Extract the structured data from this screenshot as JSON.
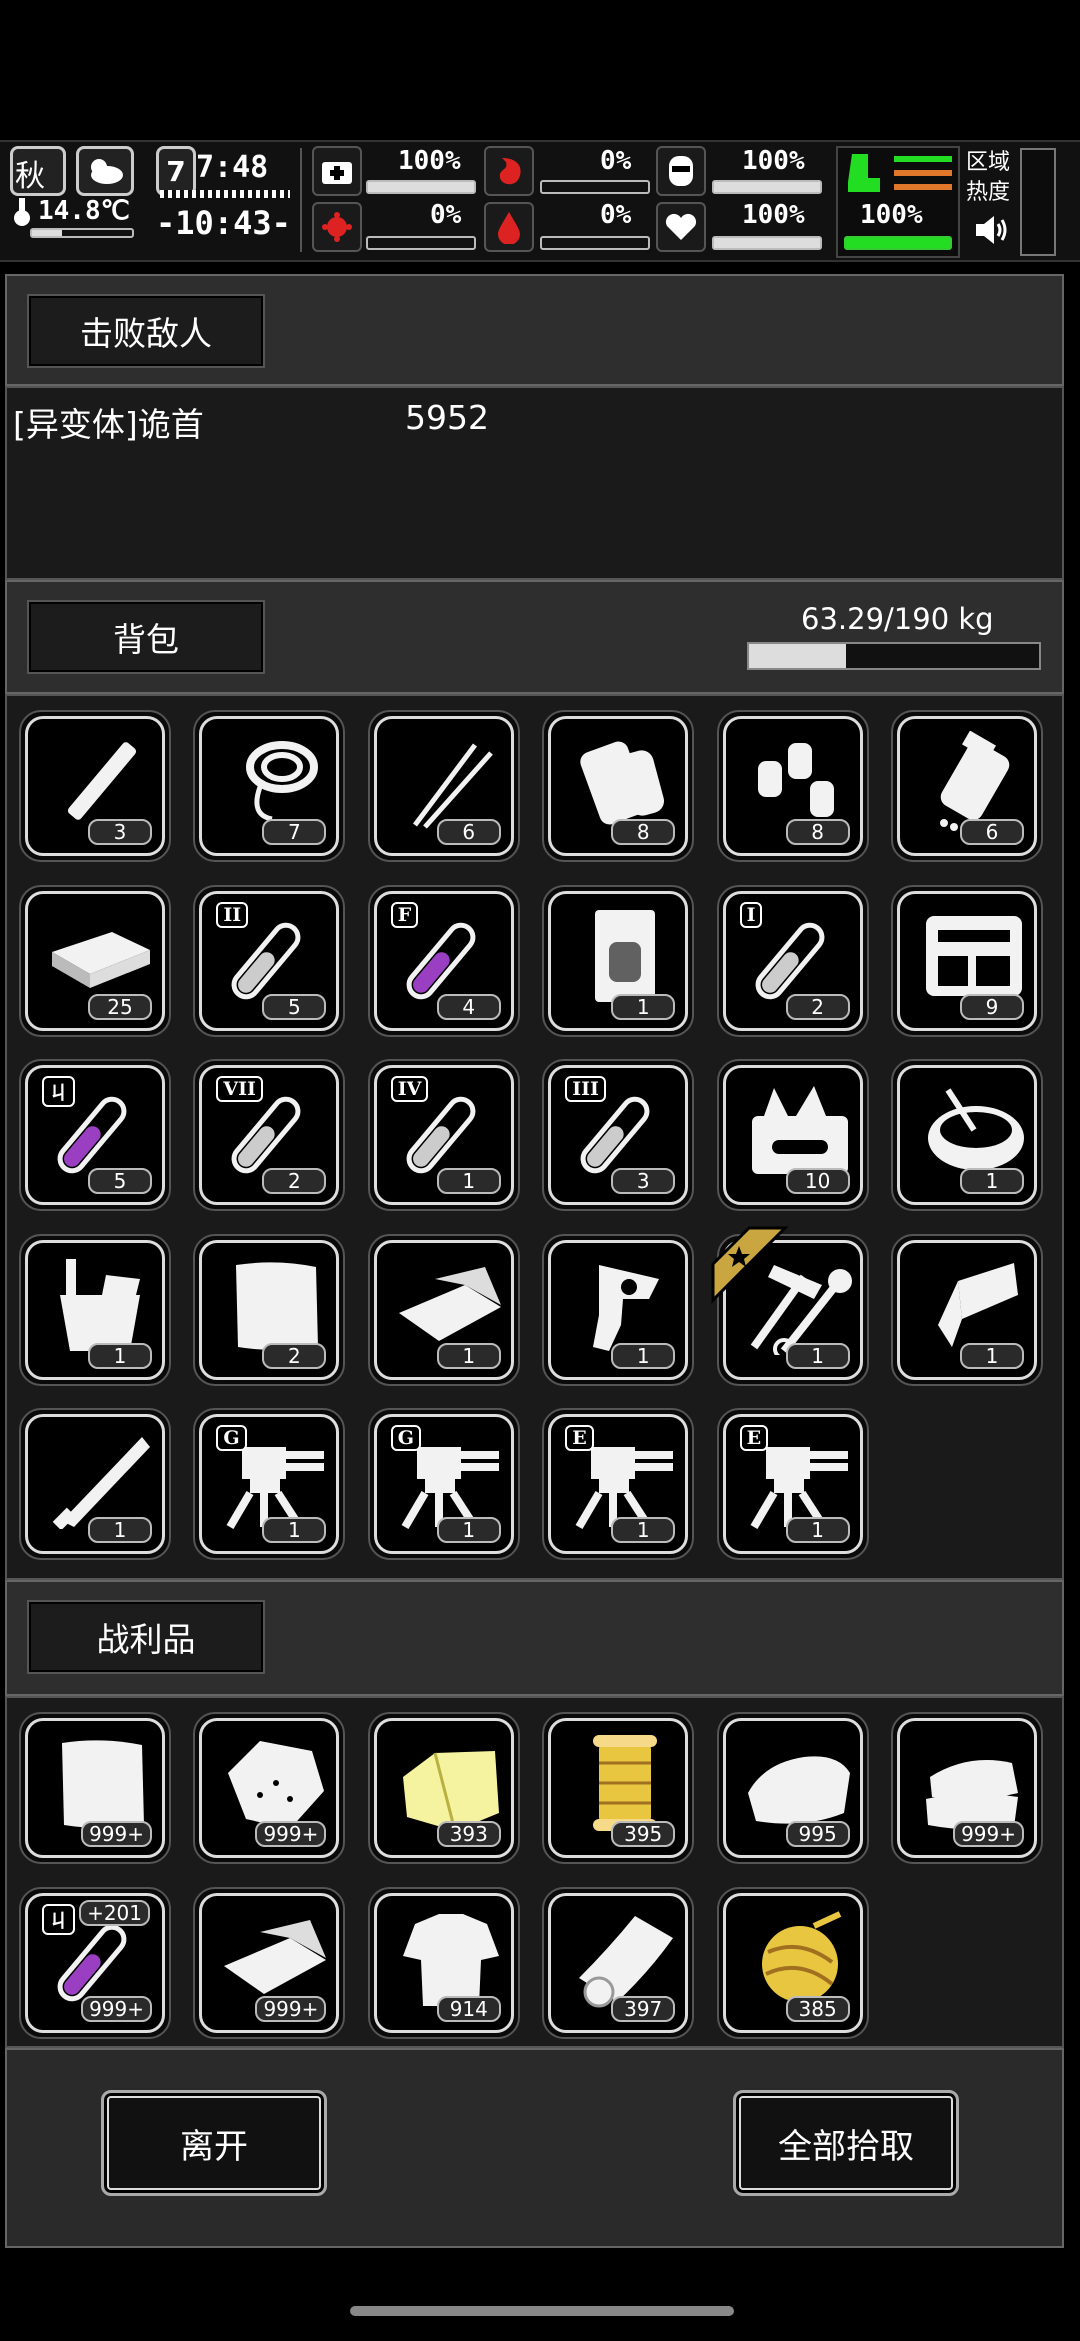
{
  "status": {
    "season": "秋",
    "day": "7",
    "day_time": "7:48",
    "temperature": "14.8℃",
    "clock": "-10:43-",
    "health": "100%",
    "hunger": "0%",
    "armor": "100%",
    "virus": "0%",
    "bleeding": "0%",
    "mood": "100%",
    "stamina": "100%",
    "zone_heat_label": "区域热度",
    "colors": {
      "green": "#22dd22",
      "red": "#dd2222",
      "orange": "#e0772a"
    }
  },
  "defeated": {
    "button_label": "击败敌人",
    "enemy_name": "[异变体]诡首",
    "enemy_value": "5952"
  },
  "backpack": {
    "button_label": "背包",
    "weight": "63.29/190 kg",
    "weight_fraction": 0.333,
    "items": [
      {
        "icon": "stick-icon",
        "count": "3"
      },
      {
        "icon": "rope-icon",
        "count": "7"
      },
      {
        "icon": "tweezers-icon",
        "count": "6"
      },
      {
        "icon": "cloth-roll-icon",
        "count": "8"
      },
      {
        "icon": "gas-canisters-icon",
        "count": "8"
      },
      {
        "icon": "pill-bottle-icon",
        "count": "6"
      },
      {
        "icon": "cash-bundle-icon",
        "count": "25"
      },
      {
        "icon": "test-tube-ii-icon",
        "count": "5",
        "tag": "II"
      },
      {
        "icon": "test-tube-f-icon",
        "count": "4",
        "tag": "F"
      },
      {
        "icon": "sealed-bag-icon",
        "count": "1"
      },
      {
        "icon": "test-tube-i-icon",
        "count": "2",
        "tag": "I"
      },
      {
        "icon": "tool-case-icon",
        "count": "9"
      },
      {
        "icon": "test-tube-h-icon",
        "count": "5",
        "tag": "ㄐ"
      },
      {
        "icon": "test-tube-vii-icon",
        "count": "2",
        "tag": "VII"
      },
      {
        "icon": "test-tube-iv-icon",
        "count": "1",
        "tag": "IV"
      },
      {
        "icon": "test-tube-iii-icon",
        "count": "3",
        "tag": "III"
      },
      {
        "icon": "toolbox-icon",
        "count": "10"
      },
      {
        "icon": "bowl-icon",
        "count": "1"
      },
      {
        "icon": "bucket-icon",
        "count": "1"
      },
      {
        "icon": "cloth-sheet-icon",
        "count": "2"
      },
      {
        "icon": "folded-cloth-icon",
        "count": "1"
      },
      {
        "icon": "revolver-icon",
        "count": "1"
      },
      {
        "icon": "hammer-wrench-icon",
        "count": "1",
        "star": true
      },
      {
        "icon": "blade-icon",
        "count": "1"
      },
      {
        "icon": "machete-icon",
        "count": "1"
      },
      {
        "icon": "turret-g-icon",
        "count": "1",
        "tag": "G"
      },
      {
        "icon": "turret-g-icon",
        "count": "1",
        "tag": "G"
      },
      {
        "icon": "turret-e-icon",
        "count": "1",
        "tag": "E"
      },
      {
        "icon": "turret-e-icon",
        "count": "1",
        "tag": "E"
      }
    ]
  },
  "loot": {
    "button_label": "战利品",
    "items": [
      {
        "icon": "cloth-sheet-icon",
        "count": "999+"
      },
      {
        "icon": "rock-icon",
        "count": "999+"
      },
      {
        "icon": "yellow-fabric-icon",
        "count": "393"
      },
      {
        "icon": "thread-spool-icon",
        "count": "395"
      },
      {
        "icon": "towel-icon",
        "count": "995"
      },
      {
        "icon": "cloth-pile-icon",
        "count": "999+"
      },
      {
        "icon": "test-tube-h-icon",
        "count": "999+",
        "tag": "ㄐ",
        "extra": "+201"
      },
      {
        "icon": "folded-cloth-icon",
        "count": "999+"
      },
      {
        "icon": "torn-shirt-icon",
        "count": "914"
      },
      {
        "icon": "paper-roll-icon",
        "count": "397"
      },
      {
        "icon": "yarn-ball-icon",
        "count": "385"
      }
    ]
  },
  "footer": {
    "leave_label": "离开",
    "pickup_all_label": "全部拾取"
  }
}
